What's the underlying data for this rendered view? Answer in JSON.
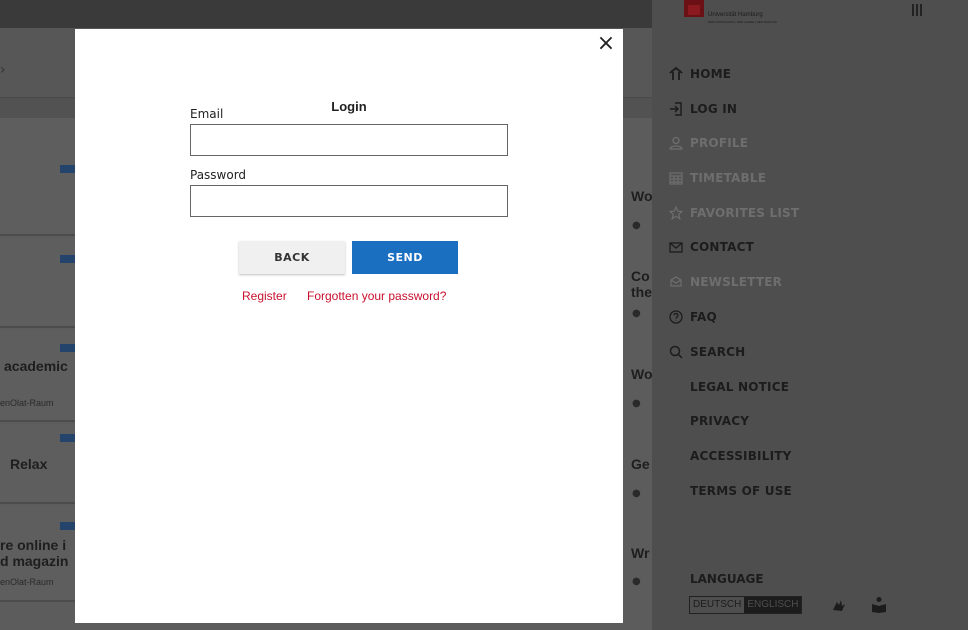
{
  "modal": {
    "title": "Login",
    "close_glyph": "×",
    "email_label": "Email",
    "email_value": "",
    "password_label": "Password",
    "password_value": "",
    "back_label": "BACK",
    "send_label": "SEND",
    "register_label": "Register",
    "forgot_label": "Forgotten your password?"
  },
  "background": {
    "texts": [
      "academic",
      "enOlat-Raum",
      "Relax",
      "re online i",
      "d magazin",
      "enOlat-Raum"
    ],
    "right_texts": [
      "Wo",
      "Co",
      "the",
      "Wo",
      "Ge",
      "Wr"
    ]
  },
  "brand": {
    "name": "Universität Hamburg",
    "subline": "DER FORSCHUNG | DER LEHRE | DER BILDUNG"
  },
  "nav": {
    "items": [
      {
        "label": "HOME",
        "icon": "home-icon",
        "state": "active"
      },
      {
        "label": "LOG IN",
        "icon": "login-icon",
        "state": "active"
      },
      {
        "label": "PROFILE",
        "icon": "profile-icon",
        "state": "disabled"
      },
      {
        "label": "TIMETABLE",
        "icon": "timetable-icon",
        "state": "disabled"
      },
      {
        "label": "FAVORITES LIST",
        "icon": "star-icon",
        "state": "disabled"
      },
      {
        "label": "CONTACT",
        "icon": "mail-icon",
        "state": "active"
      },
      {
        "label": "NEWSLETTER",
        "icon": "newsletter-icon",
        "state": "disabled"
      },
      {
        "label": "FAQ",
        "icon": "help-icon",
        "state": "active"
      },
      {
        "label": "SEARCH",
        "icon": "search-icon",
        "state": "active"
      },
      {
        "label": "LEGAL NOTICE",
        "icon": "",
        "state": "active"
      },
      {
        "label": "PRIVACY",
        "icon": "",
        "state": "active"
      },
      {
        "label": "ACCESSIBILITY",
        "icon": "",
        "state": "active"
      },
      {
        "label": "TERMS OF USE",
        "icon": "",
        "state": "active"
      }
    ],
    "language_label": "LANGUAGE",
    "lang_de": "DEUTSCH",
    "lang_en": "ENGLISCH"
  },
  "colors": {
    "brand_red": "#c8102e",
    "send_blue": "#1a6fc0",
    "overlay": "#5a5a5a"
  }
}
